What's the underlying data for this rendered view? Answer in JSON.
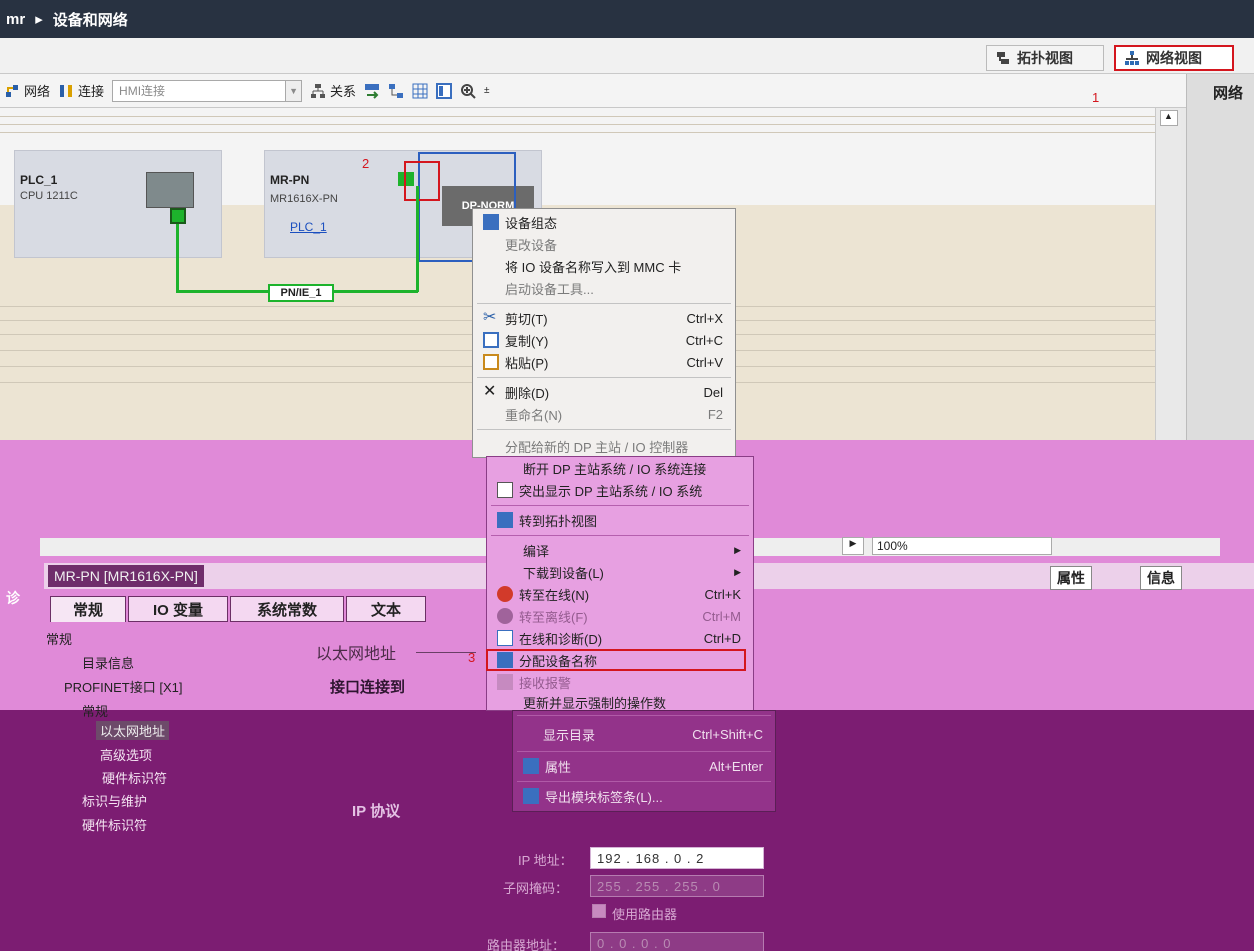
{
  "titlebar": {
    "project": "mr",
    "sep": "▸",
    "title": "设备和网络"
  },
  "views": {
    "topology": "拓扑视图",
    "network": "网络视图"
  },
  "annotations": {
    "n1": "1",
    "n2": "2",
    "n3": "3"
  },
  "toolbar": {
    "network": "网络",
    "connection": "连接",
    "hmi_conn": "HMI连接",
    "relation": "关系"
  },
  "right_panel": {
    "title": "网络"
  },
  "devices": [
    {
      "name": "PLC_1",
      "type": "CPU 1211C"
    },
    {
      "name": "MR-PN",
      "type": "MR1616X-PN",
      "link": "PLC_1",
      "module": "DP-NORM"
    }
  ],
  "network_label": "PN/IE_1",
  "context_menu": {
    "items": [
      {
        "label": "设备组态",
        "shortcut": "",
        "disabled": false
      },
      {
        "label": "更改设备",
        "shortcut": "",
        "disabled": true
      },
      {
        "label": "将 IO 设备名称写入到 MMC 卡",
        "shortcut": "",
        "disabled": false
      },
      {
        "label": "启动设备工具...",
        "shortcut": "",
        "disabled": true
      },
      {
        "label": "剪切(T)",
        "shortcut": "Ctrl+X",
        "disabled": false
      },
      {
        "label": "复制(Y)",
        "shortcut": "Ctrl+C",
        "disabled": false
      },
      {
        "label": "粘贴(P)",
        "shortcut": "Ctrl+V",
        "disabled": false
      },
      {
        "label": "删除(D)",
        "shortcut": "Del",
        "disabled": false
      },
      {
        "label": "重命名(N)",
        "shortcut": "F2",
        "disabled": true
      },
      {
        "label": "分配给新的 DP 主站 / IO 控制器",
        "shortcut": "",
        "disabled": true
      },
      {
        "label": "断开 DP 主站系统 / IO 系统连接",
        "shortcut": "",
        "disabled": false
      },
      {
        "label": "突出显示 DP 主站系统 / IO 系统",
        "shortcut": "",
        "disabled": false
      },
      {
        "label": "转到拓扑视图",
        "shortcut": "",
        "disabled": false
      },
      {
        "label": "编译",
        "shortcut": "",
        "disabled": false
      },
      {
        "label": "下载到设备(L)",
        "shortcut": "",
        "disabled": false
      },
      {
        "label": "转至在线(N)",
        "shortcut": "Ctrl+K",
        "disabled": false
      },
      {
        "label": "转至离线(F)",
        "shortcut": "Ctrl+M",
        "disabled": true
      },
      {
        "label": "在线和诊断(D)",
        "shortcut": "Ctrl+D",
        "disabled": false
      },
      {
        "label": "分配设备名称",
        "shortcut": "",
        "disabled": false
      },
      {
        "label": "接收报警",
        "shortcut": "",
        "disabled": true
      },
      {
        "label": "更新并显示强制的操作数",
        "shortcut": "",
        "disabled": false
      },
      {
        "label": "显示目录",
        "shortcut": "Ctrl+Shift+C",
        "disabled": false
      },
      {
        "label": "属性",
        "shortcut": "Alt+Enter",
        "disabled": false
      },
      {
        "label": "导出模块标签条(L)...",
        "shortcut": "",
        "disabled": false
      }
    ]
  },
  "zoom": "100%",
  "properties": {
    "header": "MR-PN [MR1616X-PN]",
    "btn_props": "属性",
    "btn_info": "信息",
    "tabs": [
      "常规",
      "IO 变量",
      "系统常数",
      "文本"
    ],
    "diag_tab": "诊",
    "nav": {
      "general": "常规",
      "catalog": "目录信息",
      "profinet": "PROFINET接口 [X1]",
      "general2": "常规",
      "eth_addr": "以太网地址",
      "advanced": "高级选项",
      "hw_id": "硬件标识符",
      "id_maint": "标识与维护",
      "hw_id2": "硬件标识符"
    },
    "section_eth": "以太网地址",
    "section_iface": "接口连接到",
    "section_ip": "IP 协议",
    "ip_label": "IP 地址：",
    "ip_value": "192 . 168 . 0    . 2",
    "mask_label": "子网掩码：",
    "mask_value": "255 . 255 . 255 . 0",
    "use_router": "使用路由器",
    "router_label": "路由器地址：",
    "router_value": "0    . 0    . 0    . 0"
  }
}
